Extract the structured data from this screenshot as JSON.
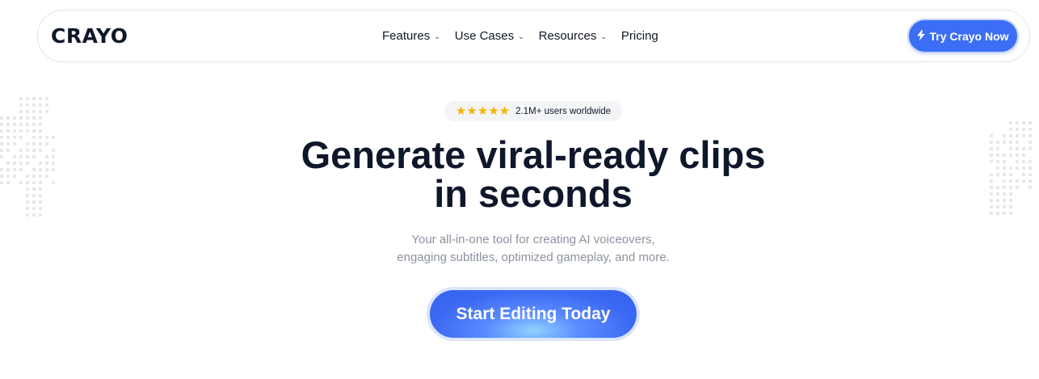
{
  "nav": {
    "logo": "CRAYO",
    "links": [
      {
        "label": "Features",
        "dropdown": true
      },
      {
        "label": "Use Cases",
        "dropdown": true
      },
      {
        "label": "Resources",
        "dropdown": true
      },
      {
        "label": "Pricing",
        "dropdown": false
      }
    ],
    "cta_label": "Try Crayo Now",
    "cta_icon": "lightning-icon"
  },
  "hero": {
    "rating": {
      "stars": "★★★★★",
      "star_count": 5,
      "text": "2.1M+ users worldwide"
    },
    "headline_line1": "Generate viral-ready clips",
    "headline_line2": "in seconds",
    "subtext_line1": "Your all-in-one tool for creating AI voiceovers,",
    "subtext_line2": "engaging subtitles, optimized gameplay, and more.",
    "cta_label": "Start Editing Today"
  },
  "colors": {
    "accent": "#3b6ef5",
    "star": "#f5b301",
    "heading": "#0f172a",
    "muted": "#8b92a0"
  }
}
